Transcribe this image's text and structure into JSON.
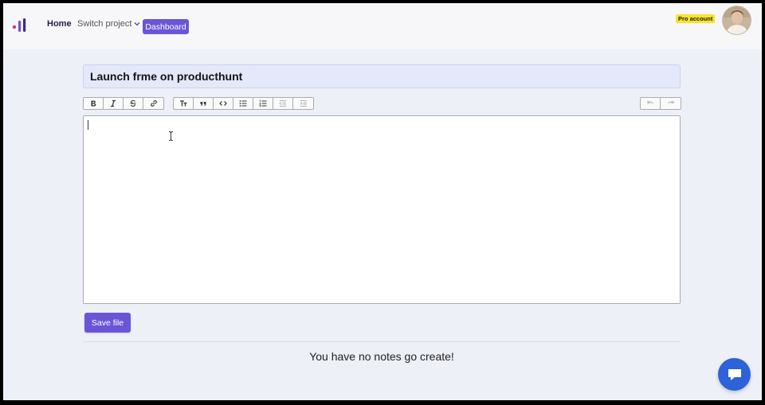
{
  "header": {
    "nav": {
      "home_label": "Home",
      "switch_project_label": "Switch project",
      "dashboard_label": "Dashboard"
    },
    "pro_badge": "Pro account",
    "accent_color": "#6b55d6"
  },
  "editor": {
    "title_value": "Launch frme on producthunt",
    "toolbar": {
      "format_group": [
        "bold-icon",
        "italic-icon",
        "strikethrough-icon",
        "link-icon"
      ],
      "block_group": [
        "heading-icon",
        "quote-icon",
        "code-icon",
        "bullet-list-icon",
        "numbered-list-icon",
        "outdent-icon",
        "indent-icon"
      ],
      "history_group": [
        "undo-icon",
        "redo-icon"
      ]
    },
    "body_value": ""
  },
  "actions": {
    "save_label": "Save file"
  },
  "notes": {
    "empty_message": "You have no notes go create!"
  },
  "chat": {
    "icon": "chat-bubble-icon",
    "color": "#2c63d9"
  }
}
